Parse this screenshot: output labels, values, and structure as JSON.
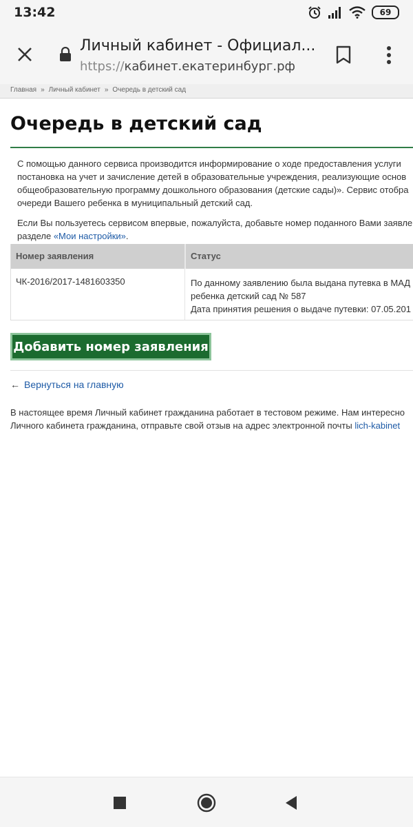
{
  "status_bar": {
    "time": "13:42",
    "battery": "69",
    "icons": [
      "alarm-icon",
      "signal-icon",
      "wifi-icon",
      "battery-icon"
    ]
  },
  "browser": {
    "page_title": "Личный кабинет - Официал...",
    "url_scheme": "https://",
    "url_host": "кабинет.екатеринбург.рф"
  },
  "breadcrumb": {
    "items": [
      "Главная",
      "Личный кабинет",
      "Очередь в детский сад"
    ],
    "separator": "»"
  },
  "page": {
    "title": "Очередь в детский сад",
    "intro_lines": [
      "С помощью данного сервиса производится информирование о ходе предоставления услуги",
      "постановка на учет и зачисление детей в образовательные учреждения, реализующие основ",
      "общеобразовательную программу дошкольного образования (детские сады)». Сервис отобра",
      "очереди Вашего ребенка в муниципальный детский сад."
    ],
    "first_time_line1": "Если Вы пользуетесь сервисом впервые, пожалуйста, добавьте номер поданного Вами заявле",
    "first_time_line2_prefix": "разделе ",
    "settings_link": "«Мои настройки»",
    "first_time_line2_suffix": "."
  },
  "table": {
    "headers": [
      "Номер заявления",
      "Статус"
    ],
    "rows": [
      {
        "number": "ЧК-2016/2017-1481603350",
        "status_lines": [
          "По данному заявлению была выдана путевка в МАД",
          "ребенка детский сад № 587",
          "Дата принятия решения о выдаче путевки: 07.05.201"
        ]
      }
    ]
  },
  "actions": {
    "add_button": "Добавить номер заявления",
    "back_arrow": "←",
    "back_link": "Вернуться на главную"
  },
  "notice": {
    "line1": "В настоящее время Личный кабинет гражданина работает в тестовом режиме. Нам интересно",
    "line2_prefix": "Личного кабинета гражданина, отправьте свой отзыв на адрес электронной почты ",
    "email_link": "lich-kabinet"
  },
  "colors": {
    "accent_green": "#1b6b2f",
    "link_blue": "#1d5aa6",
    "table_header_bg": "#cfcfcf"
  }
}
